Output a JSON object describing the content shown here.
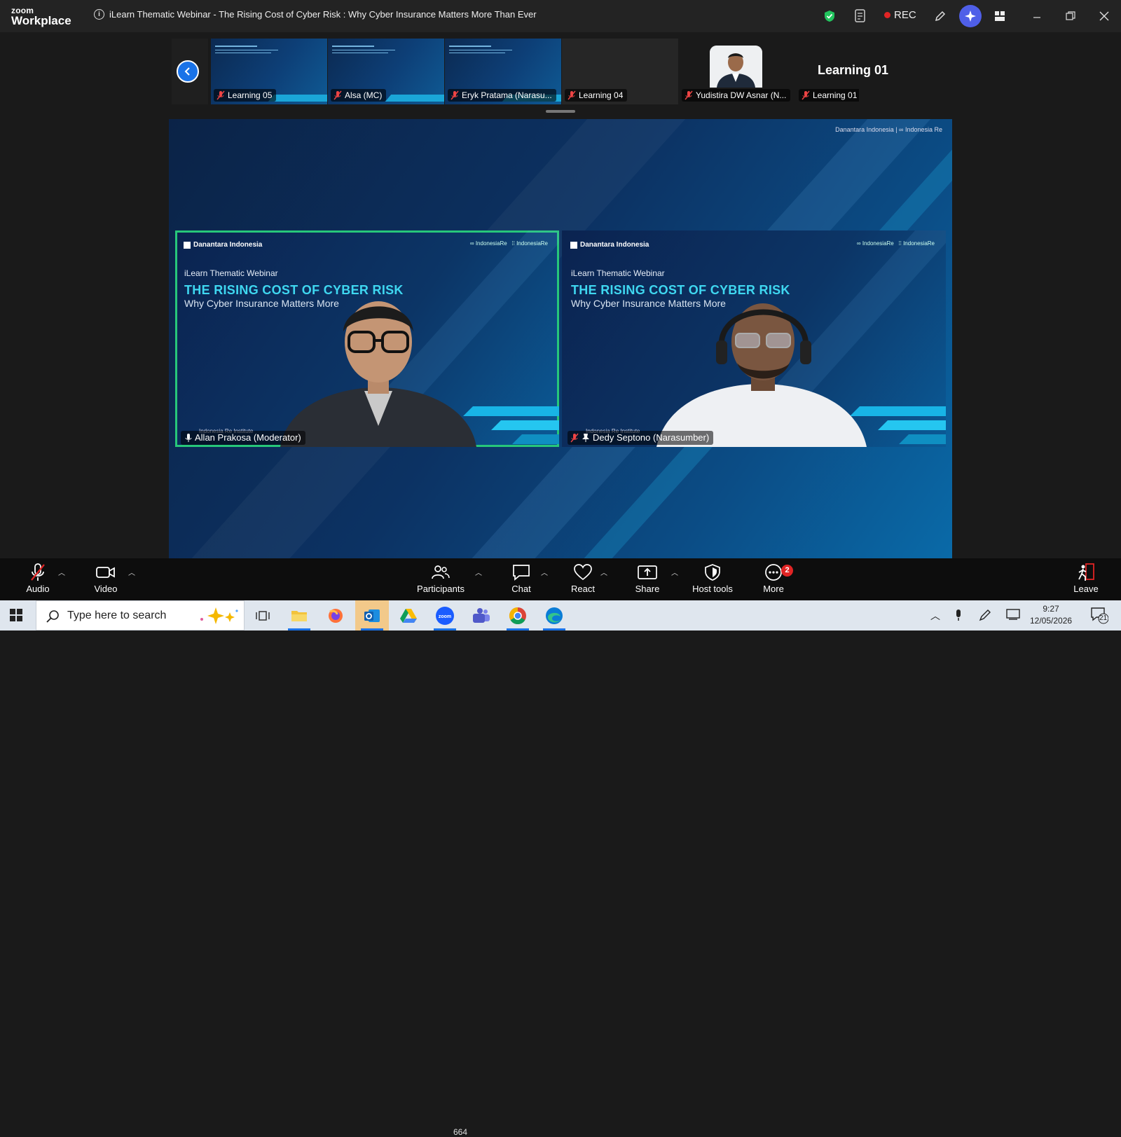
{
  "app": {
    "logo_top": "zoom",
    "logo_bottom": "Workplace",
    "meeting_title": "iLearn Thematic Webinar - The Rising Cost of Cyber Risk : Why Cyber Insurance Matters More Than Ever",
    "rec_label": "REC"
  },
  "filmstrip": {
    "tiles": [
      {
        "name": "Learning 05",
        "muted": true
      },
      {
        "name": "Alsa (MC)",
        "muted": true
      },
      {
        "name": "Eryk Pratama (Narasu...",
        "muted": true
      },
      {
        "name": "Learning 04",
        "muted": true
      },
      {
        "name": "Yudistira DW Asnar (N...",
        "muted": true
      },
      {
        "name": "Learning 01",
        "muted": true
      }
    ],
    "active_name": "Learning 01"
  },
  "stage": {
    "brand_small": "Danantara Indonesia",
    "tiles": [
      {
        "brand": "Danantara Indonesia",
        "subtitle": "iLearn Thematic Webinar",
        "title": "THE RISING COST OF CYBER RISK",
        "tagline": "Why Cyber Insurance Matters More",
        "institute": "Indonesia Re Institute",
        "name": "Allan Prakosa (Moderator)",
        "active": true
      },
      {
        "brand": "Danantara Indonesia",
        "subtitle": "iLearn Thematic Webinar",
        "title": "THE RISING COST OF CYBER RISK",
        "tagline": "Why Cyber Insurance Matters More",
        "institute": "Indonesia Re Institute",
        "name": "Dedy Septono (Narasumber)",
        "active": false
      }
    ]
  },
  "controls": {
    "audio": "Audio",
    "video": "Video",
    "participants": "Participants",
    "participants_count": "664",
    "chat": "Chat",
    "react": "React",
    "share": "Share",
    "host_tools": "Host tools",
    "more": "More",
    "more_badge": "2",
    "leave": "Leave"
  },
  "taskbar": {
    "search_placeholder": "Type here to search",
    "time": "9:27",
    "date": "12/05/2026",
    "notifications": "21"
  },
  "colors": {
    "accent": "#1a73e8",
    "active_speaker": "#27c77a",
    "rec": "#e02424",
    "slide_title": "#3fd7f0"
  }
}
